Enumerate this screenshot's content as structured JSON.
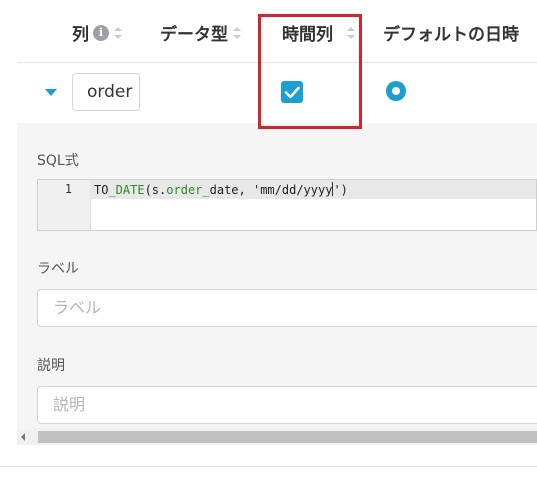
{
  "header": {
    "columns": [
      {
        "label": "列",
        "has_info": true
      },
      {
        "label": "データ型"
      },
      {
        "label": "時間列"
      },
      {
        "label": "デフォルトの日時"
      }
    ],
    "info_glyph": "i"
  },
  "row": {
    "column_input_value": "order",
    "time_column_checked": true,
    "default_datetime_selected": true
  },
  "panel": {
    "sql_label": "SQL式",
    "code": {
      "line_number": "1",
      "tokens": [
        {
          "text": "TO",
          "kw": false
        },
        {
          "text": "_DATE",
          "kw": true
        },
        {
          "text": "(s.",
          "kw": false
        },
        {
          "text": "order_",
          "kw": true
        },
        {
          "text": "date, 'mm/dd/yyyy",
          "kw": false
        },
        {
          "text": "')",
          "kw": false
        }
      ]
    },
    "label_label": "ラベル",
    "label_placeholder": "ラベル",
    "description_label": "説明",
    "description_placeholder": "説明"
  },
  "colors": {
    "accent": "#1a9fd0",
    "highlight": "#d9232a"
  },
  "icons": {
    "expand": "caret-down-icon",
    "check": "checkmark-icon",
    "radio": "radio-selected-icon",
    "info": "info-icon",
    "sort": "sort-icon"
  }
}
